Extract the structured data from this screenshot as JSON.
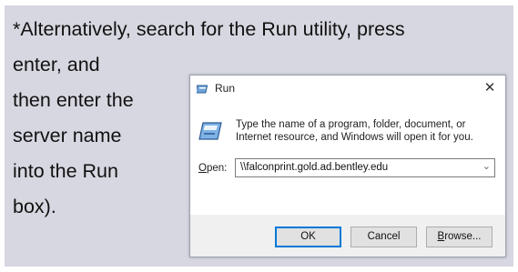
{
  "instruction": {
    "lines": [
      "*Alternatively, search for the Run utility, press",
      "enter, and",
      "then enter the",
      "server name",
      "into the Run",
      "box)."
    ]
  },
  "dialog": {
    "title": "Run",
    "title_icon": "run-icon",
    "close_glyph": "✕",
    "description": "Type the name of a program, folder, document, or Internet resource, and Windows will open it for you.",
    "open_label_mnemonic": "O",
    "open_label_rest": "pen:",
    "open_value": "\\\\falconprint.gold.ad.bentley.edu",
    "buttons": {
      "ok": "OK",
      "cancel": "Cancel",
      "browse_mnemonic": "B",
      "browse_rest": "rowse..."
    }
  },
  "colors": {
    "panel_bg": "#d7d7e1",
    "dialog_bg": "#f0f0f0",
    "accent": "#0078d7"
  }
}
